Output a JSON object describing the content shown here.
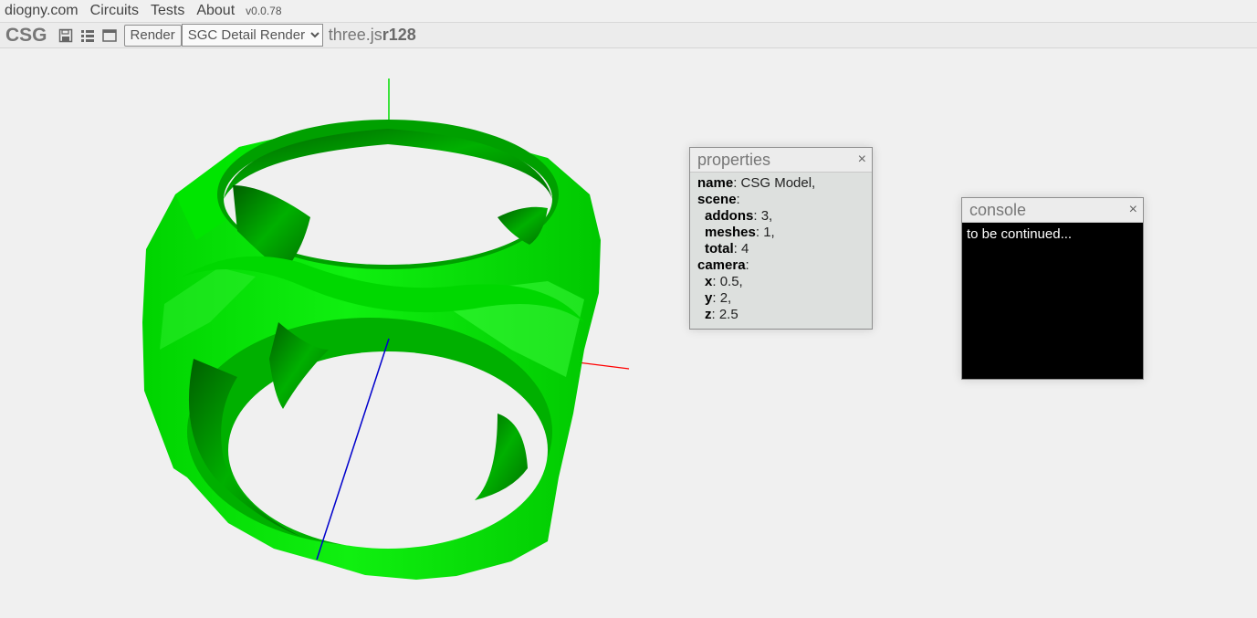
{
  "menubar": {
    "site": "diogny.com",
    "items": [
      "Circuits",
      "Tests",
      "About"
    ],
    "version": "v0.0.78"
  },
  "toolbar": {
    "title": "CSG",
    "icons": [
      "save-icon",
      "list-icon",
      "window-icon"
    ],
    "render_label": "Render",
    "select_value": "SGC Detail Render",
    "lib_name": "three.js",
    "lib_version": "r128"
  },
  "scene": {
    "model_color": "#00e000",
    "axis_colors": {
      "x": "#ff0000",
      "y": "#00dd00",
      "z": "#0000cc"
    }
  },
  "properties": {
    "title": "properties",
    "close": "×",
    "name_key": "name",
    "name_val": "CSG Model,",
    "scene_key": "scene",
    "addons_key": "addons",
    "addons_val": "3,",
    "meshes_key": "meshes",
    "meshes_val": "1,",
    "total_key": "total",
    "total_val": "4",
    "camera_key": "camera",
    "x_key": "x",
    "x_val": "0.5,",
    "y_key": "y",
    "y_val": "2,",
    "z_key": "z",
    "z_val": "2.5"
  },
  "console": {
    "title": "console",
    "close": "×",
    "text": "to be continued..."
  }
}
